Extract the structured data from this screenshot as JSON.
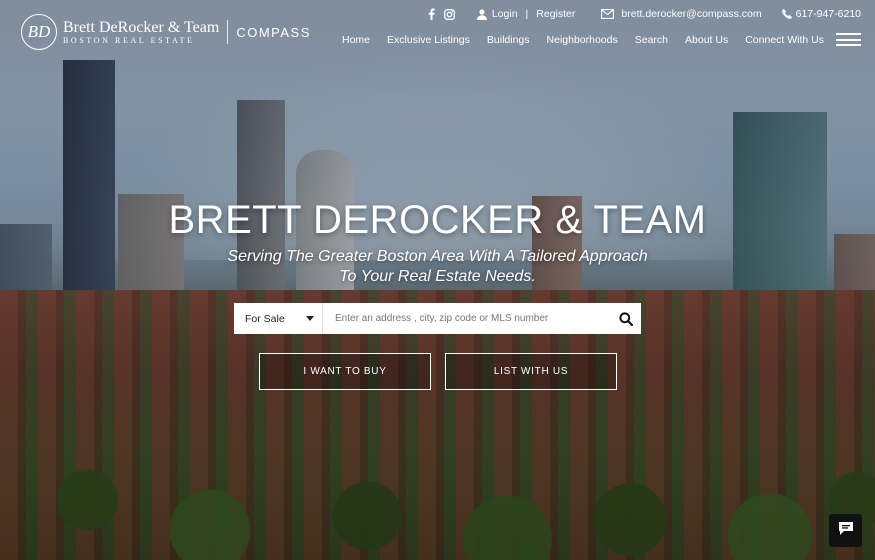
{
  "logo": {
    "monogram": "BD",
    "name": "Brett DeRocker & Team",
    "subtitle": "BOSTON REAL ESTATE",
    "brand": "COMPASS"
  },
  "topbar": {
    "social_icons": [
      "facebook-icon",
      "instagram-icon"
    ],
    "login_label": "Login",
    "separator": "|",
    "register_label": "Register",
    "email": "brett.derocker@compass.com",
    "phone": "617-947-6210"
  },
  "nav": {
    "items": [
      "Home",
      "Exclusive Listings",
      "Buildings",
      "Neighborhoods",
      "Search",
      "About Us",
      "Connect With Us"
    ]
  },
  "hero": {
    "title": "BRETT DEROCKER & TEAM",
    "subtitle_line1": "Serving The Greater Boston Area With A Tailored Approach",
    "subtitle_line2": "To Your Real Estate Needs."
  },
  "search": {
    "selected_option": "For Sale",
    "placeholder": "Enter an address , city, zip code or MLS number"
  },
  "ctas": {
    "buy_label": "I WANT TO BUY",
    "list_label": "LIST WITH US"
  },
  "colors": {
    "text": "#ffffff",
    "chat_button": "#111111"
  }
}
